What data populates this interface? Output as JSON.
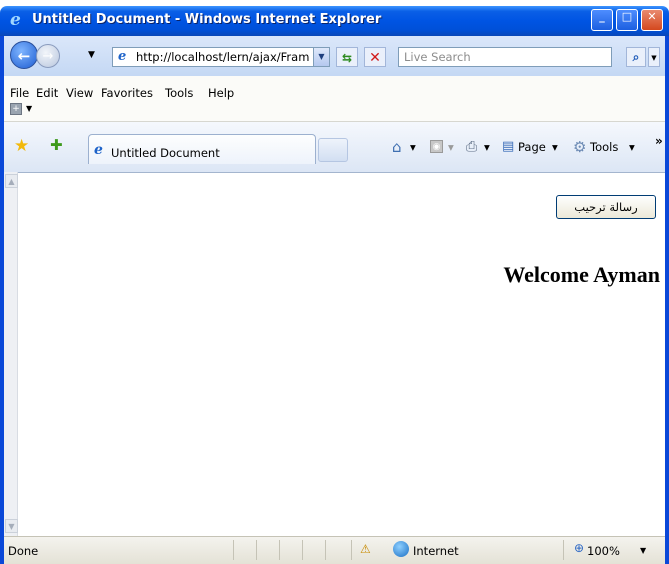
{
  "window": {
    "title": "Untitled Document - Windows Internet Explorer",
    "colors": {
      "titlebar": "#0054e3",
      "close": "#d4481e"
    }
  },
  "address_bar": {
    "url": "http://localhost/lern/ajax/Fram",
    "search_placeholder": "Live Search"
  },
  "menu": {
    "items": [
      "File",
      "Edit",
      "View",
      "Favorites",
      "Tools",
      "Help"
    ]
  },
  "tabs": [
    {
      "label": "Untitled Document"
    }
  ],
  "command_bar": {
    "page_label": "Page",
    "tools_label": "Tools"
  },
  "content": {
    "button_label": "رسالة ترحيب",
    "heading": "Welcome Ayman"
  },
  "status_bar": {
    "status": "Done",
    "zone": "Internet",
    "zoom": "100%"
  }
}
